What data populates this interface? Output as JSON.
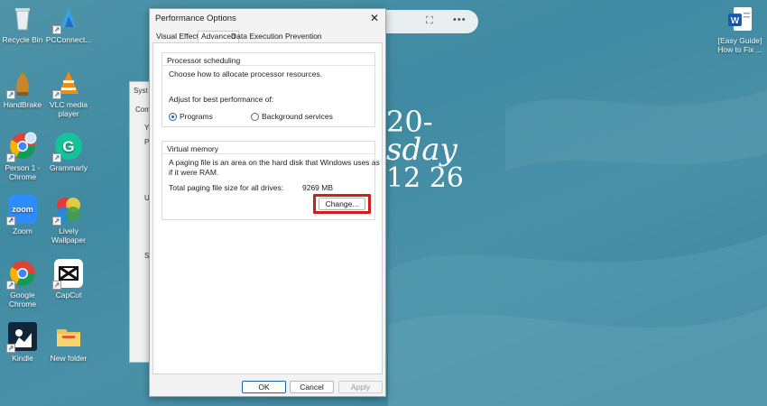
{
  "desktop": {
    "icons": [
      {
        "label1": "Recycle Bin",
        "label2": "",
        "icon": "recycle-bin-icon"
      },
      {
        "label1": "PCConnect...",
        "label2": "",
        "icon": "pc-connect-icon"
      },
      {
        "label1": "HandBrake",
        "label2": "",
        "icon": "handbrake-icon"
      },
      {
        "label1": "VLC media",
        "label2": "player",
        "icon": "vlc-icon"
      },
      {
        "label1": "Person 1 -",
        "label2": "Chrome",
        "icon": "chrome-person-icon"
      },
      {
        "label1": "Grammarly",
        "label2": "",
        "icon": "grammarly-icon"
      },
      {
        "label1": "Zoom",
        "label2": "",
        "icon": "zoom-icon"
      },
      {
        "label1": "Lively",
        "label2": "Wallpaper",
        "icon": "lively-icon"
      },
      {
        "label1": "Google",
        "label2": "Chrome",
        "icon": "chrome-icon"
      },
      {
        "label1": "CapCut",
        "label2": "",
        "icon": "capcut-icon"
      },
      {
        "label1": "Kindle",
        "label2": "",
        "icon": "kindle-icon"
      },
      {
        "label1": "New folder",
        "label2": "",
        "icon": "folder-icon"
      },
      {
        "label1": "[Easy Guide]",
        "label2": "How to Fix ...",
        "icon": "word-doc-icon"
      }
    ],
    "zoom_icon_text": "zoom",
    "word_icon_text": "W",
    "clock": {
      "line1": "20-",
      "line2": "sday",
      "line3": "12 26"
    },
    "pill_icons": [
      "focus-icon",
      "more-icon"
    ],
    "more_text": "•••",
    "bg_window": {
      "t1": "Syst",
      "t2": "Com",
      "t3": "Y",
      "t4": "P",
      "t5": "U",
      "t6": "S"
    }
  },
  "dialog": {
    "title": "Performance Options",
    "close_glyph": "✕",
    "tabs": [
      "Visual Effects",
      "Advanced",
      "Data Execution Prevention"
    ],
    "active_tab": "Advanced",
    "processor": {
      "heading": "Processor scheduling",
      "description": "Choose how to allocate processor resources.",
      "adjust_label": "Adjust for best performance of:",
      "option_programs": "Programs",
      "option_background": "Background services",
      "selected": "Programs"
    },
    "virtual_memory": {
      "heading": "Virtual memory",
      "desc_line1": "A paging file is an area on the hard disk that Windows uses as",
      "desc_line2": "if it were RAM.",
      "total_label": "Total paging file size for all drives:",
      "total_value": "9269 MB",
      "change_button": "Change..."
    },
    "buttons": {
      "ok": "OK",
      "cancel": "Cancel",
      "apply": "Apply"
    },
    "highlight_color": "#d31c1c",
    "accent_color": "#1a63a9"
  }
}
